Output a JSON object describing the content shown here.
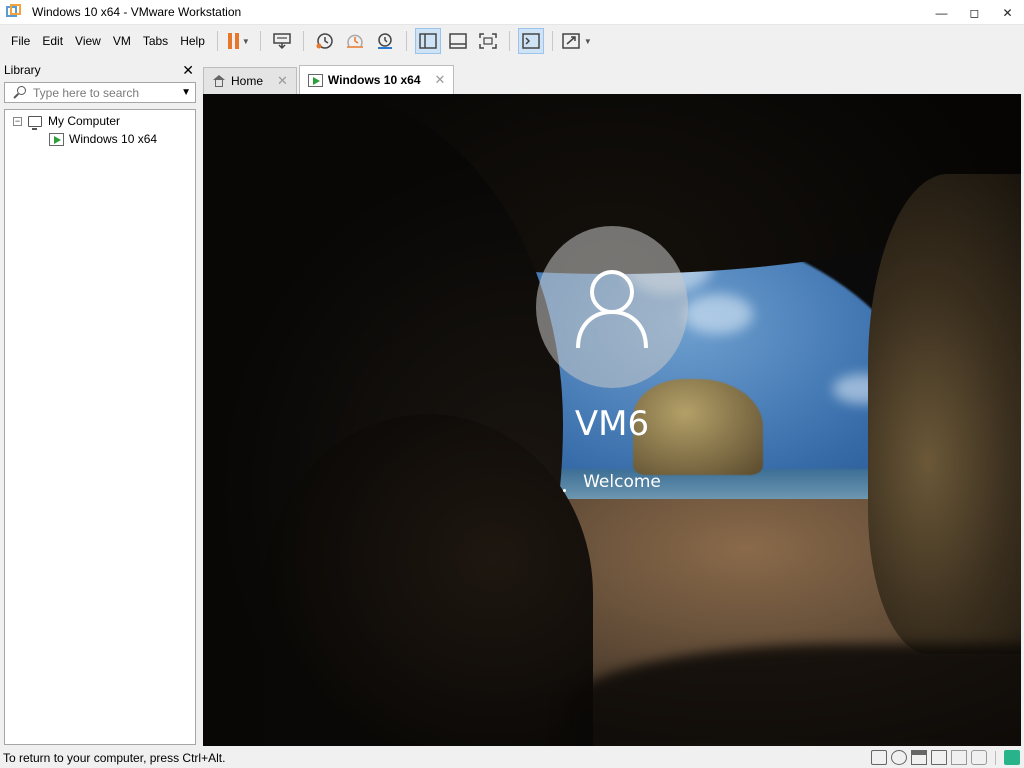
{
  "window": {
    "title": "Windows 10 x64 - VMware Workstation",
    "minimize_glyph": "—",
    "maximize_glyph": "◻",
    "close_glyph": "✕"
  },
  "menu": [
    "File",
    "Edit",
    "View",
    "VM",
    "Tabs",
    "Help"
  ],
  "toolbar_icons": [
    "pause-icon",
    "send-ctrl-alt-del-icon",
    "snapshot-icon",
    "revert-snapshot-icon",
    "snapshot-manager-icon",
    "show-library-icon",
    "thumbnail-bar-icon",
    "fit-guest-icon",
    "console-view-icon",
    "full-screen-icon"
  ],
  "library": {
    "title": "Library",
    "close_glyph": "✕",
    "search_placeholder": "Type here to search",
    "tree": {
      "root_label": "My Computer",
      "toggle": "−",
      "children": [
        "Windows 10 x64"
      ]
    }
  },
  "tabs": [
    {
      "label": "Home",
      "active": false
    },
    {
      "label": "Windows 10 x64",
      "active": true
    }
  ],
  "tab_close_glyph": "✕",
  "vm_screen": {
    "user_name": "VM6",
    "status": "Welcome"
  },
  "status_bar": {
    "text": "To return to your computer, press Ctrl+Alt.",
    "icons": [
      "hard-disk-icon",
      "cd-dvd-icon",
      "floppy-icon",
      "network-icon",
      "usb-icon",
      "sound-icon",
      "message-icon"
    ]
  },
  "colors": {
    "pause_orange": "#e8772e",
    "vm_run_green": "#2e9d3a",
    "message_green": "#27b48b"
  }
}
